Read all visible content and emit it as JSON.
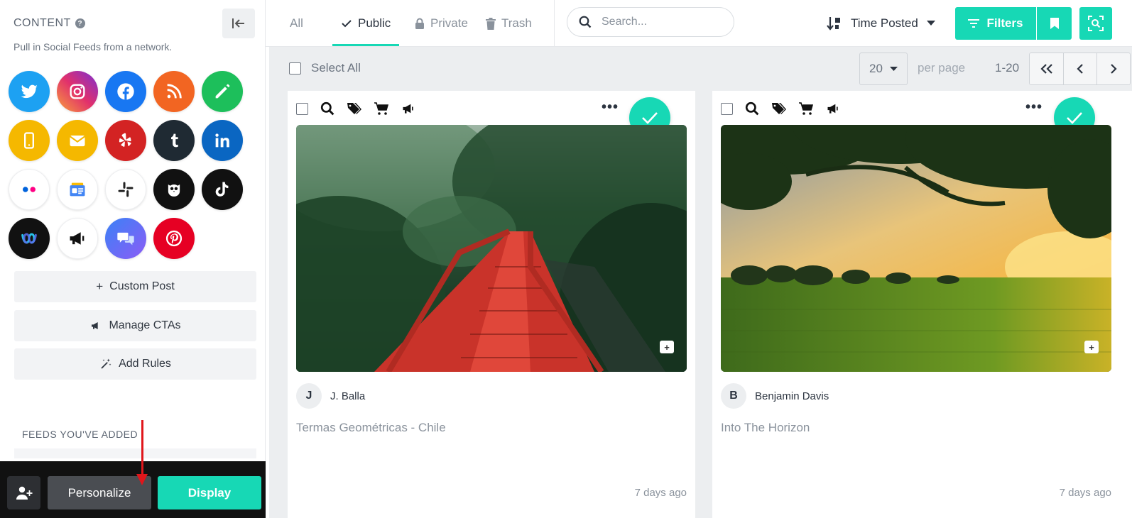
{
  "sidebar": {
    "heading": "CONTENT",
    "subtitle": "Pull in Social Feeds from a network.",
    "networks": [
      {
        "name": "twitter",
        "color": "#1da1f2"
      },
      {
        "name": "instagram",
        "color": "#e1306c"
      },
      {
        "name": "facebook",
        "color": "#1877f2"
      },
      {
        "name": "rss",
        "color": "#f26522"
      },
      {
        "name": "custom-edit",
        "color": "#1dbf5b"
      },
      {
        "name": "mobile",
        "color": "#f5b800"
      },
      {
        "name": "email",
        "color": "#f5b800"
      },
      {
        "name": "yelp",
        "color": "#d32323"
      },
      {
        "name": "tumblr",
        "color": "#1f2a33"
      },
      {
        "name": "linkedin",
        "color": "#0a66c2"
      },
      {
        "name": "flickr",
        "color": "#ffffff"
      },
      {
        "name": "google-news",
        "color": "#ffffff"
      },
      {
        "name": "slack",
        "color": "#ffffff"
      },
      {
        "name": "hootsuite",
        "color": "#111111"
      },
      {
        "name": "tiktok",
        "color": "#111111"
      },
      {
        "name": "webex",
        "color": "#111111"
      },
      {
        "name": "megaphone",
        "color": "#ffffff"
      },
      {
        "name": "chat",
        "color": "#3b82f6"
      },
      {
        "name": "pinterest",
        "color": "#e60023"
      }
    ],
    "actions": {
      "custom_post": "Custom Post",
      "manage_ctas": "Manage CTAs",
      "add_rules": "Add Rules"
    },
    "feeds_label": "FEEDS YOU'VE ADDED",
    "bottom": {
      "personalize": "Personalize",
      "display": "Display"
    }
  },
  "topbar": {
    "tabs": [
      {
        "label": "All",
        "active": false
      },
      {
        "label": "Public",
        "active": true
      },
      {
        "label": "Private",
        "active": false
      },
      {
        "label": "Trash",
        "active": false
      }
    ],
    "search_placeholder": "Search...",
    "sort_label": "Time Posted",
    "filters_label": "Filters"
  },
  "listbar": {
    "select_all": "Select All",
    "per_page_value": "20",
    "per_page_label": "per page",
    "range": "1-20"
  },
  "posts": [
    {
      "avatar_letter": "J",
      "author": "J. Balla",
      "title": "Termas Geométricas - Chile",
      "time": "7 days ago",
      "approved": true
    },
    {
      "avatar_letter": "B",
      "author": "Benjamin Davis",
      "title": "Into The Horizon",
      "time": "7 days ago",
      "approved": true
    }
  ],
  "colors": {
    "accent": "#17d8b5",
    "annotation_arrow": "#e0161b"
  }
}
